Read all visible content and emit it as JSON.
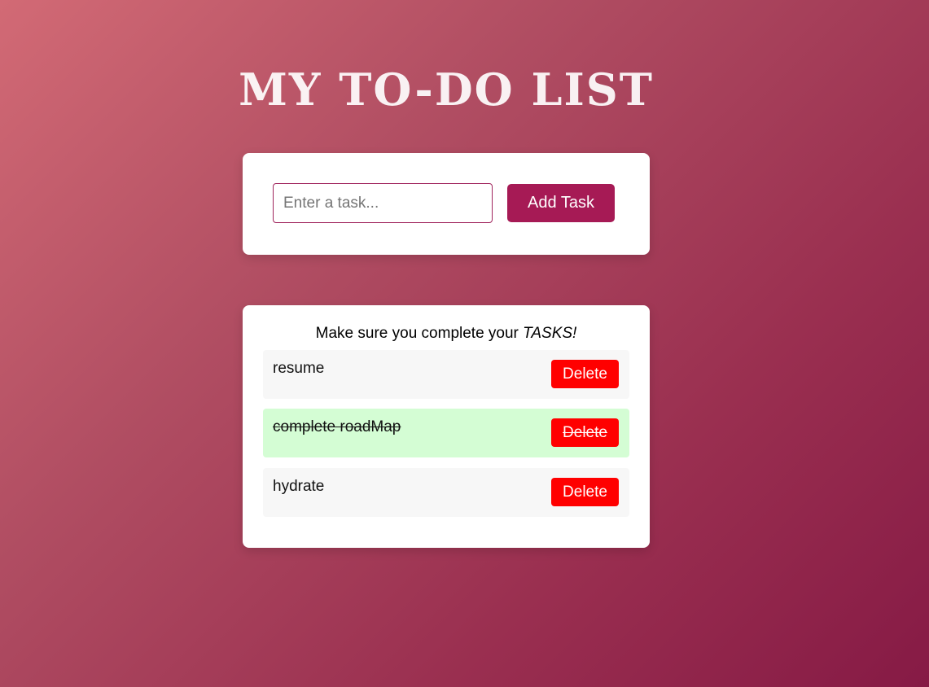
{
  "app": {
    "title": "MY TO-DO LIST"
  },
  "input_card": {
    "input_placeholder": "Enter a task...",
    "input_value": "",
    "add_button_label": "Add Task"
  },
  "list_card": {
    "heading_prefix": "Make sure you complete your ",
    "heading_emphasis": "TASKS!",
    "tasks": [
      {
        "text": "resume",
        "completed": false,
        "delete_label": "Delete"
      },
      {
        "text": "complete roadMap",
        "completed": true,
        "delete_label": "Delete"
      },
      {
        "text": "hydrate",
        "completed": false,
        "delete_label": "Delete"
      }
    ]
  },
  "colors": {
    "background_start": "#d26a75",
    "background_end": "#861a45",
    "add_button": "#a61a55",
    "delete_button": "#ff0000",
    "completed_task_bg": "#d4fdd4",
    "task_bg": "#f7f7f7"
  }
}
